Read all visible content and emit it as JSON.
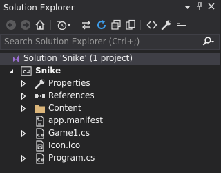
{
  "window": {
    "title": "Solution Explorer",
    "controls": [
      "dropdown-icon",
      "pin-icon",
      "close-icon"
    ]
  },
  "toolbar": {
    "buttons": [
      "back-icon",
      "forward-icon",
      "home-icon",
      "history-icon",
      "sync-icon",
      "refresh-icon",
      "collapse-all-icon",
      "copy-icon",
      "code-icon",
      "wrench-icon",
      "minus-icon"
    ]
  },
  "search": {
    "placeholder": "Search Solution Explorer (Ctrl+;)"
  },
  "tree": {
    "solution_label": "Solution 'Snike' (1 project)",
    "project_label": "Snike",
    "items": [
      {
        "label": "Properties",
        "icon": "wrench-icon",
        "expandable": true
      },
      {
        "label": "References",
        "icon": "references-icon",
        "expandable": true
      },
      {
        "label": "Content",
        "icon": "folder-icon",
        "expandable": true
      },
      {
        "label": "app.manifest",
        "icon": "manifest-icon",
        "expandable": false
      },
      {
        "label": "Game1.cs",
        "icon": "csharp-file-icon",
        "expandable": true
      },
      {
        "label": "Icon.ico",
        "icon": "image-file-icon",
        "expandable": false
      },
      {
        "label": "Program.cs",
        "icon": "csharp-file-icon",
        "expandable": true
      }
    ]
  },
  "colors": {
    "background": "#252526",
    "chrome": "#2d2d30",
    "selection": "#3f3f46",
    "accent_blue": "#3c9be8",
    "folder": "#dcb67a",
    "vs_purple": "#9b6fd2"
  }
}
